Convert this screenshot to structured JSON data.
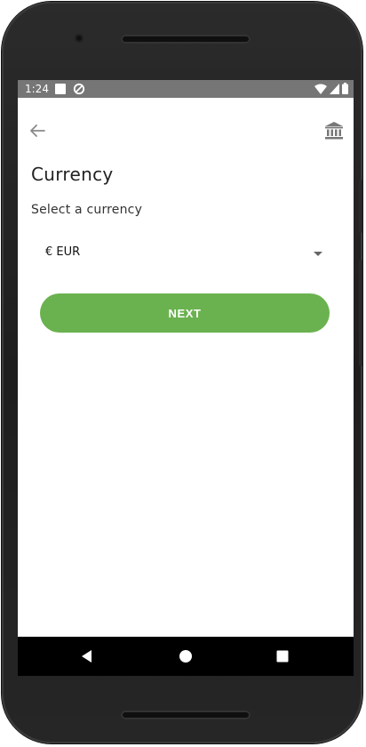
{
  "status_bar": {
    "time": "1:24",
    "icons": [
      "notification-square-icon",
      "sync-icon",
      "wifi-icon",
      "signal-icon",
      "battery-icon"
    ]
  },
  "app_bar": {
    "back_icon": "arrow-left-icon",
    "bank_icon": "bank-icon"
  },
  "page": {
    "title": "Currency",
    "subtitle": "Select a currency"
  },
  "currency_select": {
    "selected": "€ EUR"
  },
  "next_button": {
    "label": "NEXT"
  },
  "nav_bar": {
    "icons": [
      "nav-back-icon",
      "nav-home-icon",
      "nav-recents-icon"
    ]
  },
  "colors": {
    "accent": "#6ab24f",
    "status_bar": "#767676",
    "nav_bar": "#000000"
  }
}
